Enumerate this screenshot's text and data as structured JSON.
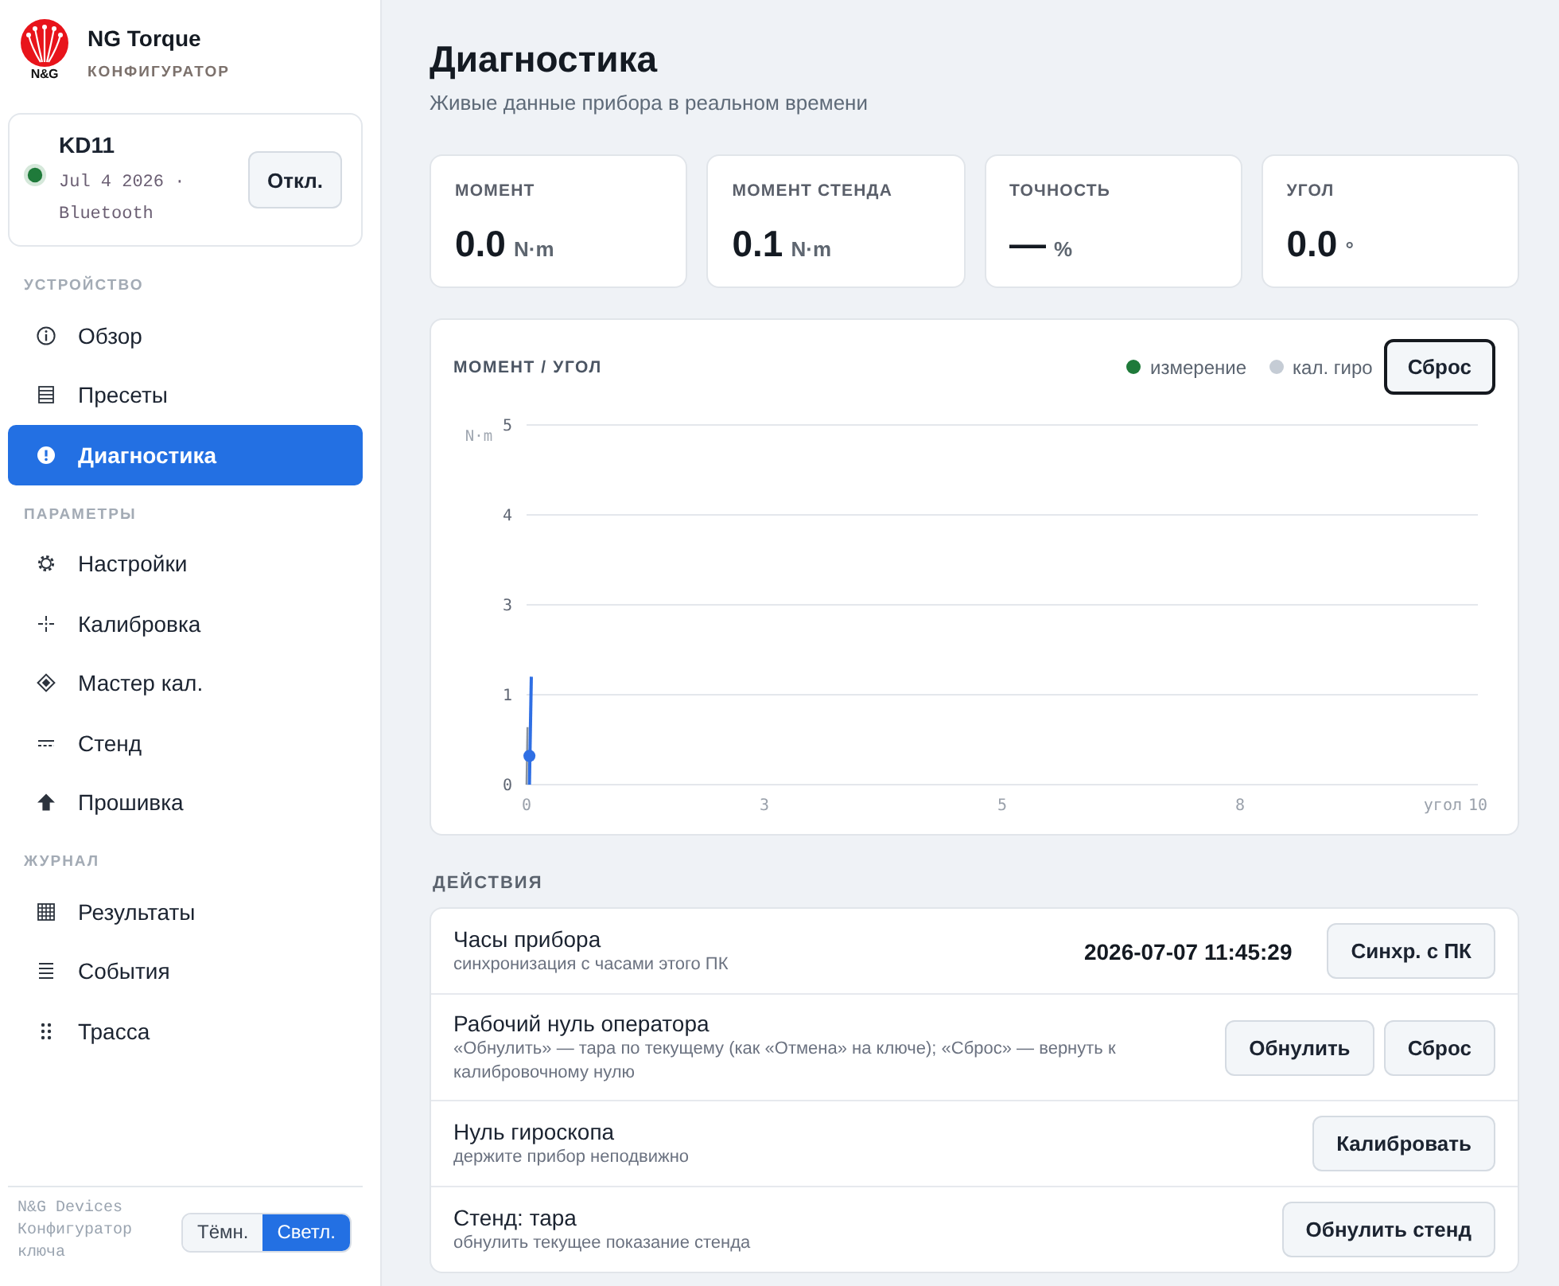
{
  "sidebar": {
    "brand": {
      "logo_text": "N&G",
      "title": "NG Torque",
      "subtitle": "КОНФИГУРАТОР"
    },
    "device": {
      "name": "KD11",
      "connected": true,
      "info": "Jul 4 2026 · Bluetooth",
      "button": "Откл."
    },
    "sections": [
      {
        "title": "УСТРОЙСТВО",
        "items": [
          {
            "label": "Обзор",
            "selected": false
          },
          {
            "label": "Пресеты",
            "selected": false
          },
          {
            "label": "Диагностика",
            "selected": true
          }
        ]
      },
      {
        "title": "ПАРАМЕТРЫ",
        "items": [
          {
            "label": "Настройки",
            "selected": false
          },
          {
            "label": "Калибровка",
            "selected": false
          },
          {
            "label": "Мастер кал.",
            "selected": false
          },
          {
            "label": "Стенд",
            "selected": false
          },
          {
            "label": "Прошивка",
            "selected": false
          }
        ]
      },
      {
        "title": "ЖУРНАЛ",
        "items": [
          {
            "label": "Результаты",
            "selected": false
          },
          {
            "label": "События",
            "selected": false
          },
          {
            "label": "Трасса",
            "selected": false
          }
        ]
      }
    ],
    "footer": {
      "text": "N&G Devices Конфигуратор ключа",
      "theme_options": [
        {
          "label": "Тёмн.",
          "selected": false
        },
        {
          "label": "Светл.",
          "selected": true
        }
      ]
    }
  },
  "page": {
    "title": "Диагностика",
    "subtitle": "Живые данные прибора в реальном времени"
  },
  "stats": [
    {
      "label": "МОМЕНТ",
      "value": "0.0",
      "unit": "N·m"
    },
    {
      "label": "МОМЕНТ СТЕНДА",
      "value": "0.1",
      "unit": "N·m"
    },
    {
      "label": "ТОЧНОСТЬ",
      "value": "—",
      "unit": "%"
    },
    {
      "label": "УГОЛ",
      "value": "0.0",
      "unit": "°"
    }
  ],
  "chart": {
    "title": "МОМЕНТ / УГОЛ",
    "legend": [
      {
        "label": "измерение",
        "color": "#1f7a3a"
      },
      {
        "label": "кал. гиро",
        "color": "#c5ccd5"
      }
    ],
    "reset_button": {
      "label": "Сброс",
      "focused": true
    },
    "chart_data": {
      "type": "line",
      "xlabel": "угол",
      "ylabel": "N·m",
      "grid": true,
      "x": [
        0,
        0.01,
        0.03,
        0.05
      ],
      "series": [
        {
          "color": "#8a929c",
          "values": [
            0,
            0.8,
            null,
            null
          ]
        },
        {
          "color": "#2f6fe4",
          "values": [
            null,
            null,
            0,
            1.5
          ]
        },
        {
          "type": "scatter",
          "color": "#2f6fe4",
          "values": [
            null,
            null,
            0.4,
            null
          ]
        }
      ],
      "xlim": [
        0,
        10
      ],
      "ylim": [
        0,
        5
      ],
      "xticks": [
        {
          "value": 0,
          "label": "0"
        },
        {
          "value": 2.5,
          "label": "3"
        },
        {
          "value": 5,
          "label": "5"
        },
        {
          "value": 7.5,
          "label": "8"
        },
        {
          "value": 10,
          "label": "10"
        }
      ],
      "yticks": [
        {
          "value": 0,
          "label": "0"
        },
        {
          "value": 1.25,
          "label": "1"
        },
        {
          "value": 2.5,
          "label": "3"
        },
        {
          "value": 3.75,
          "label": "4"
        },
        {
          "value": 5,
          "label": "5"
        }
      ]
    }
  },
  "actions": {
    "title": "ДЕЙСТВИЯ",
    "rows": [
      {
        "title": "Часы прибора",
        "description": "синхронизация с часами этого ПК",
        "value": "2026-07-07 11:45:29",
        "buttons": [
          "Синхр. с ПК"
        ]
      },
      {
        "title": "Рабочий нуль оператора",
        "description": "«Обнулить» — тара по текущему (как «Отмена» на ключе); «Сброс» — вернуть к калибровочному нулю",
        "buttons": [
          "Обнулить",
          "Сброс"
        ]
      },
      {
        "title": "Нуль гироскопа",
        "description": "держите прибор неподвижно",
        "buttons": [
          "Калибровать"
        ]
      },
      {
        "title": "Стенд: тара",
        "description": "обнулить текущее показание стенда",
        "buttons": [
          "Обнулить стенд"
        ]
      }
    ]
  }
}
